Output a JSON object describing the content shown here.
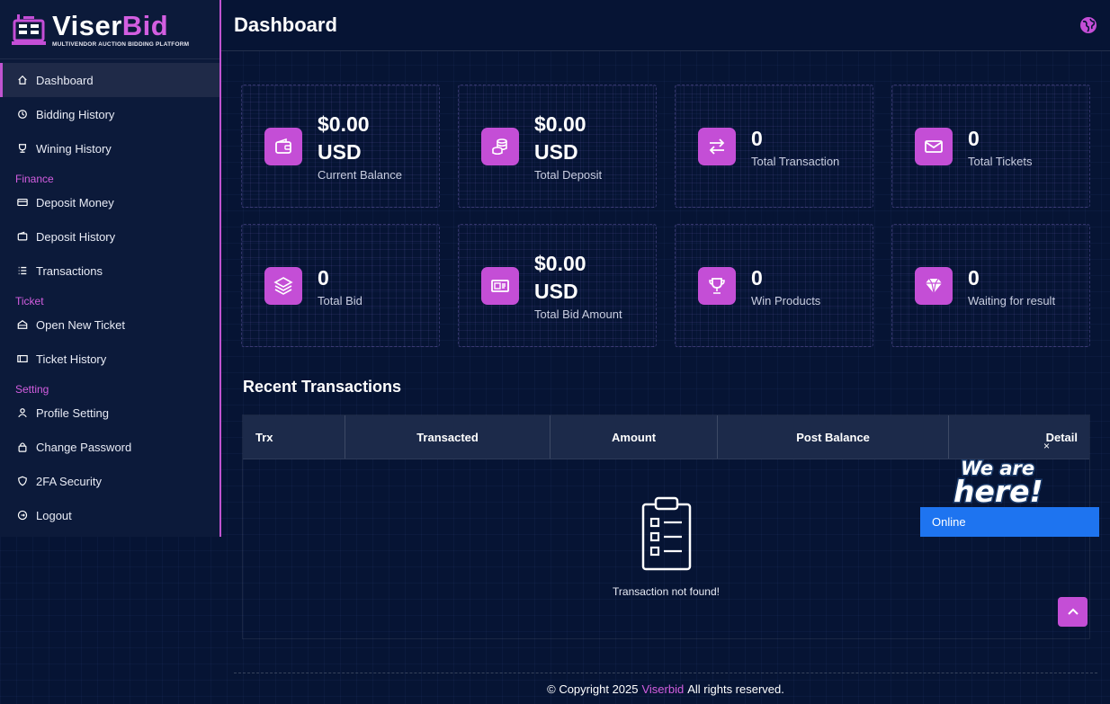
{
  "brand": {
    "name_part1": "Viser",
    "name_part2": "Bid",
    "tagline": "MULTIVENDOR AUCTION BIDDING PLATFORM"
  },
  "sidebar": {
    "items": [
      {
        "label": "Dashboard",
        "icon": "home-icon",
        "active": true
      },
      {
        "label": "Bidding History",
        "icon": "history-icon"
      },
      {
        "label": "Wining History",
        "icon": "trophy-icon"
      },
      {
        "section": "Finance"
      },
      {
        "label": "Deposit Money",
        "icon": "card-icon"
      },
      {
        "label": "Deposit History",
        "icon": "wallet-icon"
      },
      {
        "label": "Transactions",
        "icon": "list-icon"
      },
      {
        "section": "Ticket"
      },
      {
        "label": "Open New Ticket",
        "icon": "ticket-open-icon"
      },
      {
        "label": "Ticket History",
        "icon": "ticket-icon"
      },
      {
        "section": "Setting"
      },
      {
        "label": "Profile Setting",
        "icon": "user-icon"
      },
      {
        "label": "Change Password",
        "icon": "lock-icon"
      },
      {
        "label": "2FA Security",
        "icon": "shield-icon"
      },
      {
        "label": "Logout",
        "icon": "logout-icon"
      }
    ]
  },
  "header": {
    "title": "Dashboard",
    "language_icon": "globe-icon"
  },
  "cards": [
    {
      "value_line1": "$0.00",
      "value_line2": "USD",
      "label": "Current Balance",
      "icon": "wallet-icon"
    },
    {
      "value_line1": "$0.00",
      "value_line2": "USD",
      "label": "Total Deposit",
      "icon": "coins-icon"
    },
    {
      "value_line1": "0",
      "value_line2": "",
      "label": "Total Transaction",
      "icon": "exchange-icon"
    },
    {
      "value_line1": "0",
      "value_line2": "",
      "label": "Total Tickets",
      "icon": "envelope-icon"
    },
    {
      "value_line1": "0",
      "value_line2": "",
      "label": "Total Bid",
      "icon": "layers-icon"
    },
    {
      "value_line1": "$0.00",
      "value_line2": "USD",
      "label": "Total Bid Amount",
      "icon": "money-icon"
    },
    {
      "value_line1": "0",
      "value_line2": "",
      "label": "Win Products",
      "icon": "trophy-icon"
    },
    {
      "value_line1": "0",
      "value_line2": "",
      "label": "Waiting for result",
      "icon": "diamond-icon"
    }
  ],
  "recent_transactions": {
    "title": "Recent Transactions",
    "columns": [
      "Trx",
      "Transacted",
      "Amount",
      "Post Balance",
      "Detail"
    ],
    "empty_text": "Transaction not found!"
  },
  "chat": {
    "close": "×",
    "badge_line1": "We are",
    "badge_line2": "here!",
    "status": "Online"
  },
  "footer": {
    "prefix": "© Copyright 2025",
    "brand": "Viserbid",
    "suffix": "All rights reserved."
  },
  "colors": {
    "accent": "#c44ed6",
    "background": "#061434",
    "sidebar": "#0c1a3a",
    "chat_blue": "#1e74f0"
  }
}
